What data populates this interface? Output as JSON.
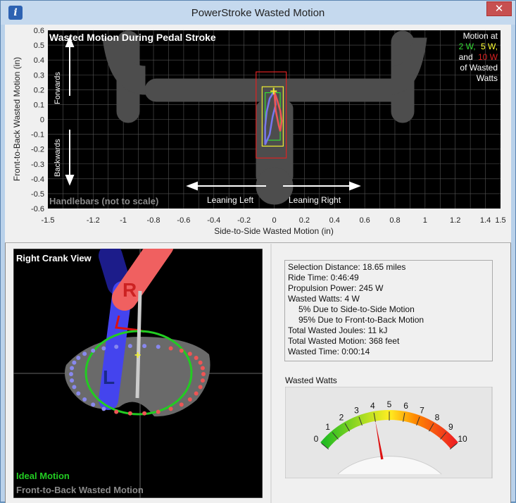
{
  "window": {
    "title": "PowerStroke Wasted Motion",
    "app_icon": "i",
    "close_glyph": "✕",
    "colors": {
      "titlebar": "#c5d9ee",
      "close": "#c75050"
    }
  },
  "chart_data": {
    "type": "scatter",
    "title": "Wasted Motion During Pedal Stroke",
    "xlabel": "Side-to-Side Wasted Motion (in)",
    "ylabel": "Front-to-Back Wasted Motion (in)",
    "xlim": [
      -1.5,
      1.5
    ],
    "ylim": [
      -0.6,
      0.6
    ],
    "x_ticks": [
      "-1.5",
      "-1.2",
      "-1",
      "-0.8",
      "-0.6",
      "-0.4",
      "-0.2",
      "0",
      "0.2",
      "0.4",
      "0.6",
      "0.8",
      "1",
      "1.2",
      "1.4",
      "1.5"
    ],
    "x_tick_values": [
      -1.5,
      -1.2,
      -1,
      -0.8,
      -0.6,
      -0.4,
      -0.2,
      0,
      0.2,
      0.4,
      0.6,
      0.8,
      1,
      1.2,
      1.4,
      1.5
    ],
    "y_ticks": [
      "0.6",
      "0.5",
      "0.4",
      "0.3",
      "0.2",
      "0.1",
      "0",
      "-0.1",
      "-0.2",
      "-0.3",
      "-0.4",
      "-0.5",
      "-0.6"
    ],
    "y_tick_values": [
      0.6,
      0.5,
      0.4,
      0.3,
      0.2,
      0.1,
      0,
      -0.1,
      -0.2,
      -0.3,
      -0.4,
      -0.5,
      -0.6
    ],
    "grid": true,
    "annotations": {
      "forwards": "Forwards",
      "backwards": "Backwards",
      "leaning_left": "Leaning Left",
      "leaning_right": "Leaning Right",
      "handlebars": "Handlebars (not to scale)"
    },
    "legend": {
      "line1": "Motion at",
      "w2": "2 W,",
      "w5": "5 W,",
      "and": "and",
      "w10": "10 W",
      "line3": "of Wasted",
      "line4": "Watts",
      "colors": {
        "w2": "#33dd33",
        "w5": "#ffff33",
        "w10": "#dd2222"
      }
    },
    "boxes": [
      {
        "name": "10 W",
        "color": "#dd2222",
        "x": [
          -0.12,
          0.08
        ],
        "y": [
          0.32,
          -0.26
        ]
      },
      {
        "name": "5 W",
        "color": "#eeee33",
        "x": [
          -0.08,
          0.06
        ],
        "y": [
          0.22,
          -0.18
        ]
      },
      {
        "name": "2 W",
        "color": "#33dd33",
        "x": [
          -0.06,
          0.04
        ],
        "y": [
          0.18,
          -0.14
        ]
      }
    ],
    "trace": [
      [
        0.0,
        0.19
      ],
      [
        -0.03,
        0.14
      ],
      [
        -0.05,
        0.05
      ],
      [
        -0.06,
        -0.05
      ],
      [
        -0.06,
        -0.17
      ],
      [
        -0.03,
        -0.1
      ],
      [
        -0.01,
        0.02
      ],
      [
        0.01,
        0.1
      ],
      [
        0.0,
        0.19
      ]
    ],
    "trace_red": [
      [
        0.0,
        0.19
      ],
      [
        0.02,
        0.13
      ],
      [
        0.04,
        0.06
      ],
      [
        0.05,
        -0.01
      ],
      [
        0.04,
        -0.08
      ],
      [
        0.03,
        -0.04
      ],
      [
        0.01,
        0.06
      ],
      [
        0.0,
        0.19
      ]
    ],
    "center_marker": [
      0.0,
      0.19
    ]
  },
  "crank": {
    "title": "Right Crank View",
    "right_label": "R",
    "left_label": "L",
    "legend_ideal": "Ideal Motion",
    "legend_wasted": "Front-to-Back Wasted Motion",
    "colors": {
      "ideal": "#22cc22",
      "wasted": "#888888",
      "right": "#f06060",
      "left": "#4444ee"
    }
  },
  "stats": {
    "selection_distance": "Selection Distance: 18.65 miles",
    "ride_time": "Ride Time: 0:46:49",
    "propulsion_power": "Propulsion Power: 245 W",
    "wasted_watts": "Wasted Watts: 4 W",
    "side_pct": "5% Due to Side-to-Side Motion",
    "front_pct": "95% Due to Front-to-Back Motion",
    "joules": "Total Wasted Joules: 11 kJ",
    "motion": "Total Wasted Motion: 368 feet",
    "time": "Wasted Time: 0:00:14"
  },
  "gauge": {
    "label": "Wasted Watts",
    "min": 0,
    "max": 10,
    "value": 4,
    "tick_labels": [
      "0",
      "1",
      "2",
      "3",
      "4",
      "5",
      "6",
      "7",
      "8",
      "9",
      "10"
    ]
  }
}
